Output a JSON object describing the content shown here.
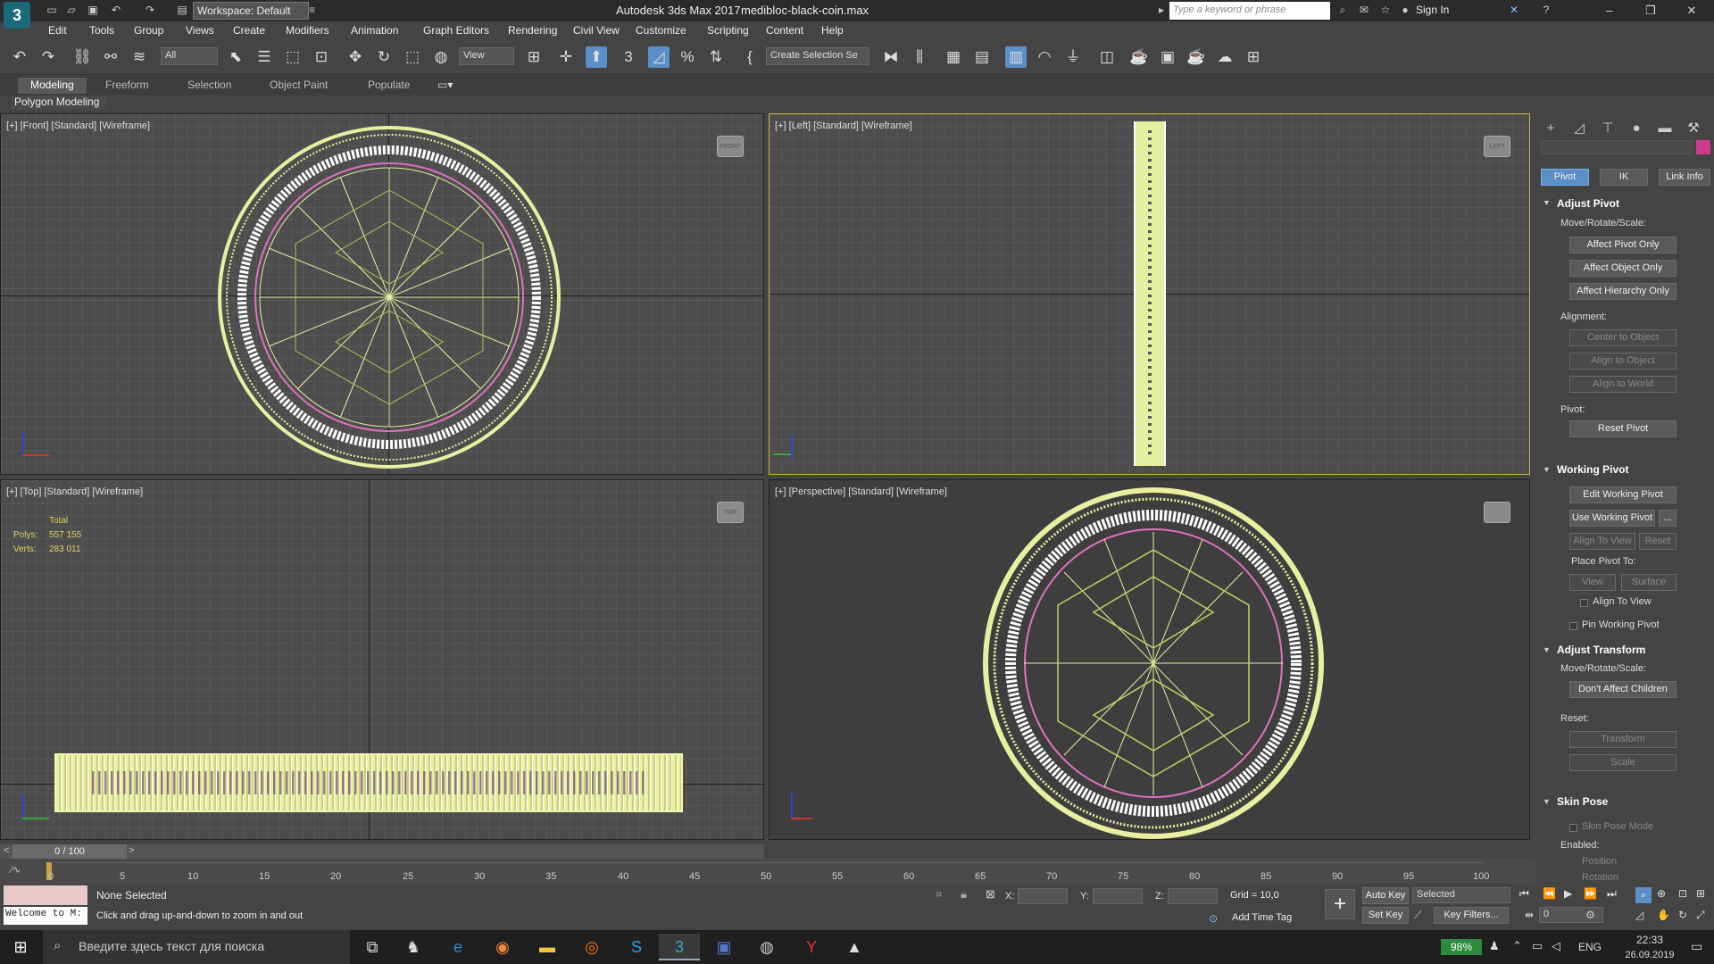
{
  "titlebar": {
    "workspace": "Workspace: Default",
    "app_title": "Autodesk 3ds Max 2017",
    "file_name": "medibloc-black-coin.max",
    "search_placeholder": "Type a keyword or phrase",
    "sign_in": "Sign In"
  },
  "menus": [
    "Edit",
    "Tools",
    "Group",
    "Views",
    "Create",
    "Modifiers",
    "Animation",
    "Graph Editors",
    "Rendering",
    "Civil View",
    "Customize",
    "Scripting",
    "Content",
    "Help"
  ],
  "toolbar": {
    "selection_filter": "All",
    "ref_coord": "View",
    "named_selection": "Create Selection Se"
  },
  "ribbon": {
    "tabs": [
      "Modeling",
      "Freeform",
      "Selection",
      "Object Paint",
      "Populate"
    ],
    "panel_label": "Polygon Modeling"
  },
  "viewports": {
    "front": {
      "label": "[+] [Front] [Standard] [Wireframe]",
      "cube": "FRONT"
    },
    "left": {
      "label": "[+] [Left] [Standard] [Wireframe]",
      "cube": "LEFT"
    },
    "top": {
      "label": "[+] [Top] [Standard] [Wireframe]",
      "cube": "TOP"
    },
    "perspective": {
      "label": "[+] [Perspective] [Standard] [Wireframe]",
      "cube": ""
    }
  },
  "stats": {
    "total": "Total",
    "polys_label": "Polys:",
    "polys_value": "557 155",
    "verts_label": "Verts:",
    "verts_value": "283 011"
  },
  "command_panel": {
    "tabs": [
      "Pivot",
      "IK",
      "Link Info"
    ],
    "adjust_pivot": {
      "title": "Adjust Pivot",
      "move_label": "Move/Rotate/Scale:",
      "affect_pivot": "Affect Pivot Only",
      "affect_object": "Affect Object Only",
      "affect_hierarchy": "Affect Hierarchy Only",
      "alignment_label": "Alignment:",
      "center": "Center to Object",
      "align_object": "Align to Object",
      "align_world": "Align to World",
      "pivot_label": "Pivot:",
      "reset_pivot": "Reset Pivot"
    },
    "working_pivot": {
      "title": "Working Pivot",
      "edit": "Edit Working Pivot",
      "use": "Use Working Pivot",
      "more": "...",
      "align_view": "Align To View",
      "reset": "Reset",
      "place_label": "Place Pivot To:",
      "view": "View",
      "surface": "Surface",
      "align_to_view_cb": "Align To View",
      "pin": "Pin Working Pivot"
    },
    "adjust_transform": {
      "title": "Adjust Transform",
      "move_label": "Move/Rotate/Scale:",
      "dont_affect": "Don't Affect Children",
      "reset_label": "Reset:",
      "transform": "Transform",
      "scale": "Scale"
    },
    "skin_pose": {
      "title": "Skin Pose",
      "mode": "Skin Pose Mode",
      "enabled_label": "Enabled:",
      "position": "Position",
      "rotation": "Rotation"
    }
  },
  "timeline": {
    "slider": "0 / 100",
    "ticks": [
      "0",
      "5",
      "10",
      "15",
      "20",
      "25",
      "30",
      "35",
      "40",
      "45",
      "50",
      "55",
      "60",
      "65",
      "70",
      "75",
      "80",
      "85",
      "90",
      "95",
      "100"
    ]
  },
  "status": {
    "maxscript": "Welcome to M:",
    "selection": "None Selected",
    "prompt": "Click and drag up-and-down to zoom in and out",
    "x_label": "X:",
    "y_label": "Y:",
    "z_label": "Z:",
    "grid": "Grid = 10,0",
    "add_time_tag": "Add Time Tag",
    "auto_key": "Auto Key",
    "set_key": "Set Key",
    "key_mode": "Selected",
    "key_filters": "Key Filters...",
    "frame": "0"
  },
  "taskbar": {
    "search_placeholder": "Введите здесь текст для поиска",
    "battery": "98%",
    "lang": "ENG",
    "time": "22:33",
    "date": "26.09.2019"
  },
  "colors": {
    "accent": "#5b8fc8",
    "active_viewport": "#d0b040",
    "wire": "#e8f0a0",
    "pink": "#e070c0"
  }
}
